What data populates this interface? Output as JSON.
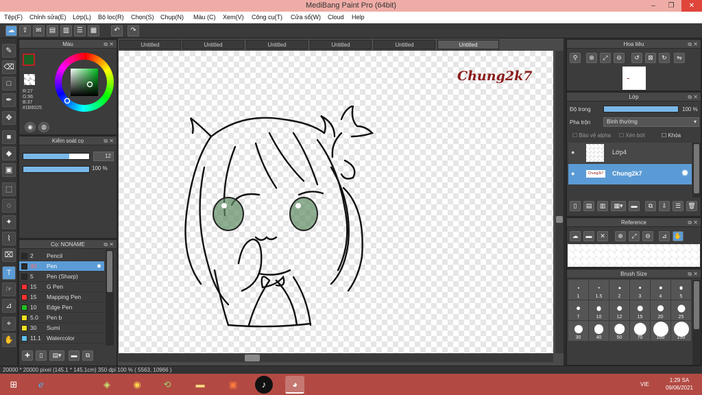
{
  "window": {
    "title": "MediBang Paint Pro (64bit)",
    "min": "–",
    "restore": "❐",
    "close": "✕"
  },
  "menu": [
    "Tệp(F)",
    "Chỉnh sửa(E)",
    "Lớp(L)",
    "Bộ lọc(R)",
    "Chọn(S)",
    "Chụp(N)",
    "Màu (C)",
    "Xem(V)",
    "Công cụ(T)",
    "Cửa sổ(W)",
    "Cloud",
    "Help"
  ],
  "color_panel": {
    "title": "Màu",
    "r": "R:27",
    "g": "G:96",
    "b": "B:37",
    "hex": "#1B6025",
    "fg": "#1b6025"
  },
  "brush_control": {
    "title": "Kiểm soát cọ",
    "size": "12",
    "opacity": "100 %",
    "size_level": 0.7,
    "opacity_level": 1.0
  },
  "brush_list": {
    "title": "Cọ: NONAME",
    "items": [
      {
        "size": "2",
        "name": "Pencil",
        "color": "#2a2a2a"
      },
      {
        "size": "40",
        "name": "Pen",
        "color": "#2a2a2a"
      },
      {
        "size": "5",
        "name": "Pen (Sharp)",
        "color": "#2a2a2a"
      },
      {
        "size": "15",
        "name": "G Pen",
        "color": "#ff3030"
      },
      {
        "size": "15",
        "name": "Mapping Pen",
        "color": "#ff3030"
      },
      {
        "size": "10",
        "name": "Edge Pen",
        "color": "#20c020"
      },
      {
        "size": "5.0",
        "name": "Pen b",
        "color": "#f0e020"
      },
      {
        "size": "30",
        "name": "Sumi",
        "color": "#f0e020"
      },
      {
        "size": "11.1",
        "name": "Watercolor",
        "color": "#60c0f0"
      }
    ]
  },
  "tabs": [
    "Untitled",
    "Untitled",
    "Untitled",
    "Untitled",
    "Untitled",
    "Untitled"
  ],
  "canvas": {
    "signature": "Chung2k7"
  },
  "navigator": {
    "title": "Hoa tiêu"
  },
  "layers": {
    "title": "Lớp",
    "opacity_label": "Độ trong",
    "opacity_value": "100 %",
    "blend_label": "Pha trộn",
    "blend_value": "Bình thường",
    "protect_alpha": "Bảo vệ alpha",
    "clipping": "Xén bớt",
    "lock": "Khóa",
    "items": [
      {
        "name": "Lớp4"
      },
      {
        "name": "Chung2k7",
        "thumb": "Chung2k7"
      }
    ]
  },
  "reference": {
    "title": "Reference"
  },
  "brush_size": {
    "title": "Brush Size",
    "sizes": [
      "1",
      "1.5",
      "2",
      "3",
      "4",
      "5",
      "7",
      "10",
      "12",
      "15",
      "20",
      "25",
      "30",
      "40",
      "50",
      "70",
      "100",
      "150"
    ]
  },
  "status": {
    "text": "20000 * 20000 pixel   (145.1 * 145.1cm)   350 dpi   100 %   ( 5563, 10966 )"
  },
  "taskbar": {
    "lang": "VIE",
    "time": "1:29 SA",
    "date": "09/06/2021"
  }
}
